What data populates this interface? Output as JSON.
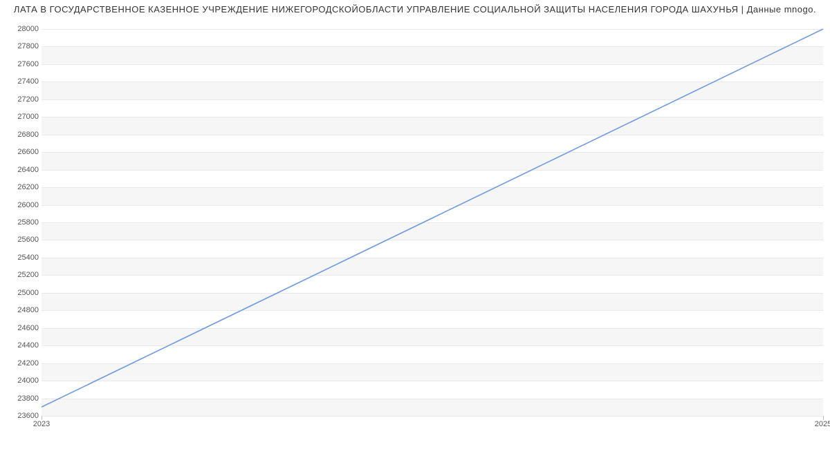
{
  "chart_data": {
    "type": "line",
    "title": "ЛАТА В ГОСУДАРСТВЕННОЕ КАЗЕННОЕ УЧРЕЖДЕНИЕ НИЖЕГОРОДСКОЙОБЛАСТИ УПРАВЛЕНИЕ СОЦИАЛЬНОЙ ЗАЩИТЫ НАСЕЛЕНИЯ ГОРОДА ШАХУНЬЯ | Данные mnogo.",
    "xlabel": "",
    "ylabel": "",
    "x": [
      2023,
      2025
    ],
    "series": [
      {
        "name": "",
        "values": [
          23700,
          28000
        ],
        "color": "#6f9ade"
      }
    ],
    "ylim": [
      23600,
      28000
    ],
    "xlim": [
      2023,
      2025
    ],
    "y_ticks": [
      23600,
      23800,
      24000,
      24200,
      24400,
      24600,
      24800,
      25000,
      25200,
      25400,
      25600,
      25800,
      26000,
      26200,
      26400,
      26600,
      26800,
      27000,
      27200,
      27400,
      27600,
      27800,
      28000
    ],
    "x_ticks": [
      2023,
      2025
    ]
  }
}
